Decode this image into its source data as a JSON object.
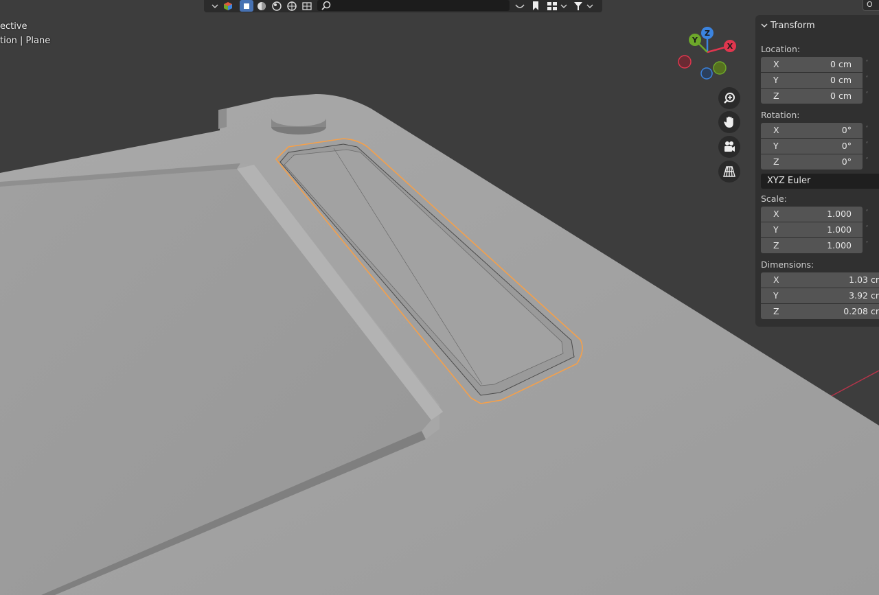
{
  "viewport": {
    "info_line1": "ective",
    "info_line2": "tion | Plane"
  },
  "header": {
    "search_icon": "search-icon",
    "corner_button_label": "O"
  },
  "gizmo": {
    "x_label": "X",
    "y_label": "Y",
    "z_label": "Z",
    "colors": {
      "x": "#e0364e",
      "y": "#6da82a",
      "z": "#3b84e0"
    }
  },
  "navigation": {
    "zoom_icon": "zoom-in-icon",
    "pan_icon": "hand-icon",
    "camera_icon": "camera-icon",
    "grid_icon": "perspective-grid-icon"
  },
  "panel": {
    "title": "Transform",
    "location": {
      "label": "Location:",
      "x": {
        "axis": "X",
        "value": "0 cm"
      },
      "y": {
        "axis": "Y",
        "value": "0 cm"
      },
      "z": {
        "axis": "Z",
        "value": "0 cm"
      }
    },
    "rotation": {
      "label": "Rotation:",
      "x": {
        "axis": "X",
        "value": "0°"
      },
      "y": {
        "axis": "Y",
        "value": "0°"
      },
      "z": {
        "axis": "Z",
        "value": "0°"
      },
      "mode": "XYZ Euler"
    },
    "scale": {
      "label": "Scale:",
      "x": {
        "axis": "X",
        "value": "1.000"
      },
      "y": {
        "axis": "Y",
        "value": "1.000"
      },
      "z": {
        "axis": "Z",
        "value": "1.000"
      }
    },
    "dimensions": {
      "label": "Dimensions:",
      "x": {
        "axis": "X",
        "value": "1.03 cr"
      },
      "y": {
        "axis": "Y",
        "value": "3.92 cr"
      },
      "z": {
        "axis": "Z",
        "value": "0.208 cr"
      }
    }
  },
  "colors": {
    "selection_outline": "#f5a04a",
    "x_axis_line": "#b8344a",
    "background": "#3d3d3d"
  }
}
